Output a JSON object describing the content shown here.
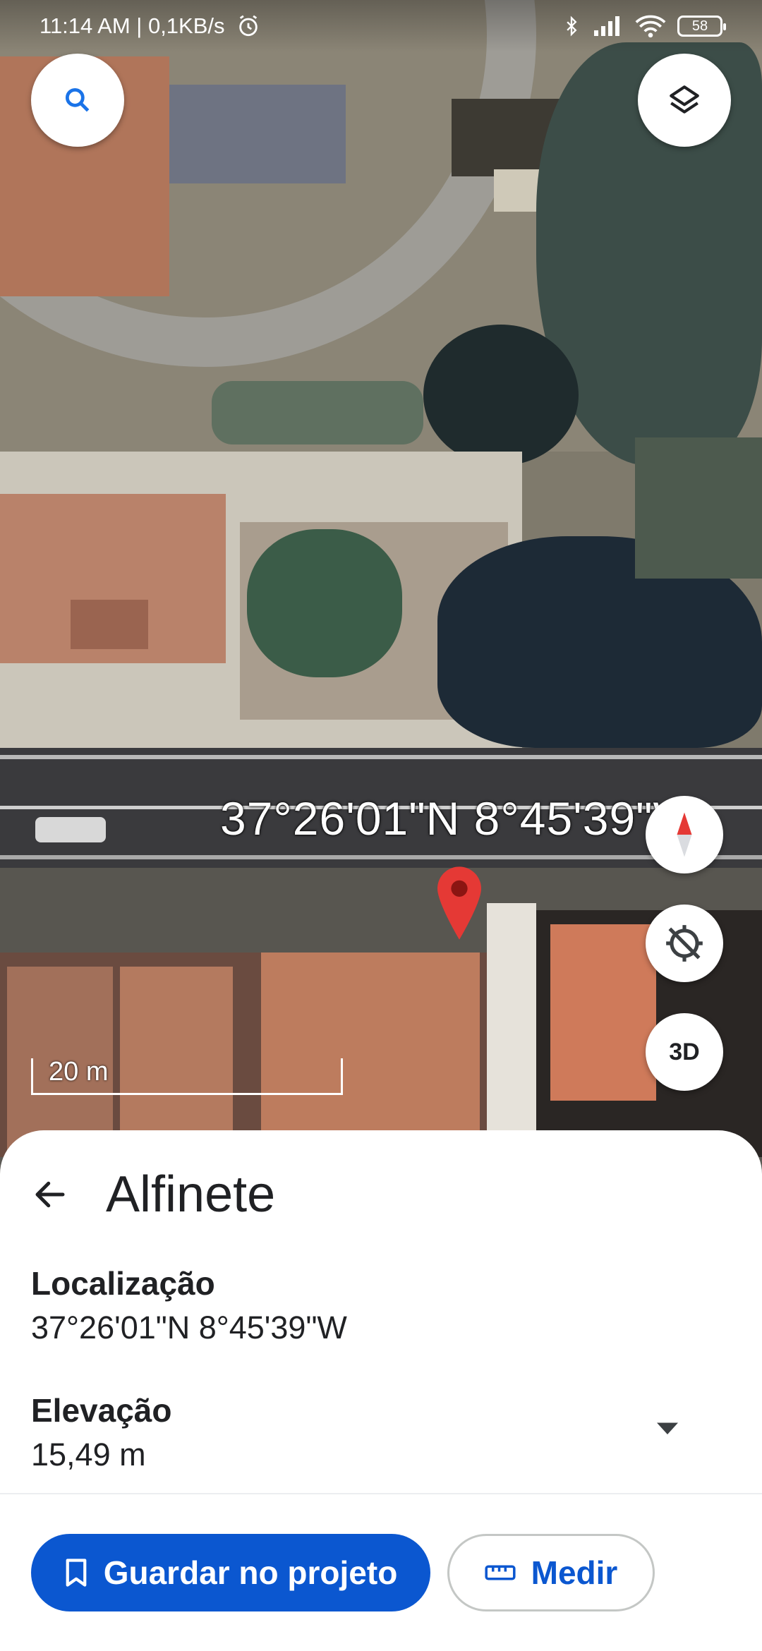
{
  "status_bar": {
    "time_speed": "11:14 AM | 0,1KB/s",
    "battery": "58"
  },
  "map": {
    "coordinate_label": "37°26'01\"N 8°45'39\"W",
    "scale_label": "20 m",
    "view_mode_label": "3D",
    "icons": {
      "search": "search-icon",
      "layers": "layers-icon",
      "compass": "compass-icon",
      "location": "location-off-icon",
      "pin": "map-pin-icon"
    }
  },
  "sheet": {
    "title": "Alfinete",
    "location_label": "Localização",
    "location_value": "37°26'01\"N 8°45'39\"W",
    "elevation_label": "Elevação",
    "elevation_value": "15,49 m",
    "save_button": "Guardar no projeto",
    "measure_button": "Medir"
  },
  "colors": {
    "primary_blue": "#0b57d0",
    "pin_red": "#e53935"
  }
}
